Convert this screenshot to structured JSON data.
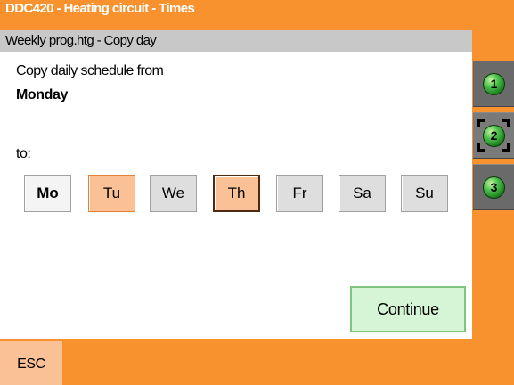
{
  "header": {
    "title": "DDC420 - Heating circuit - Times",
    "subtitle": "Weekly prog.htg - Copy day"
  },
  "content": {
    "copy_label": "Copy daily schedule from",
    "source_day": "Monday",
    "to_label": "to:",
    "days": [
      {
        "label": "Mo",
        "state": "source"
      },
      {
        "label": "Tu",
        "state": "selected"
      },
      {
        "label": "We",
        "state": "unselected"
      },
      {
        "label": "Th",
        "state": "selected-focused"
      },
      {
        "label": "Fr",
        "state": "unselected"
      },
      {
        "label": "Sa",
        "state": "unselected"
      },
      {
        "label": "Su",
        "state": "unselected"
      }
    ],
    "continue_label": "Continue"
  },
  "side_buttons": [
    {
      "label": "1",
      "icon": "green-ball-icon"
    },
    {
      "label": "2",
      "icon": "green-ball-icon",
      "active": true
    },
    {
      "label": "3",
      "icon": "green-ball-icon"
    }
  ],
  "footer": {
    "esc_label": "ESC"
  },
  "colors": {
    "background": "#f7922f",
    "subtitle_bar": "#c8c8c8",
    "selected_day": "#fbc196",
    "continue_button": "#d6f5d6",
    "side_panel": "#6a6a6a"
  }
}
